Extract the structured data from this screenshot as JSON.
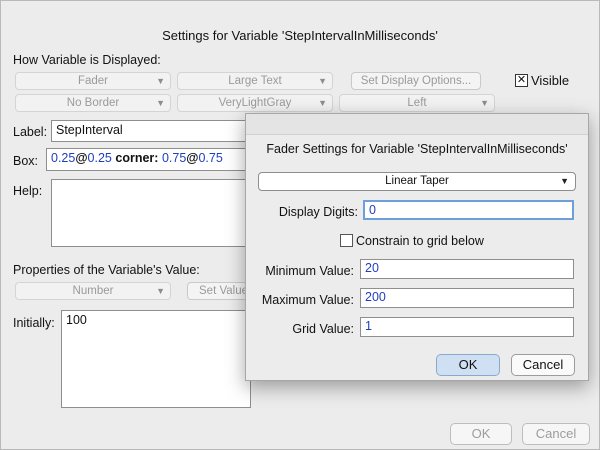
{
  "main": {
    "title": "Settings for Variable 'StepIntervalInMilliseconds'",
    "how_displayed_label": "How Variable is Displayed:",
    "display_popup1": "Fader",
    "display_popup2": "Large Text",
    "set_display_options": "Set Display Options...",
    "visible_label": "Visible",
    "visible_mark": "✕",
    "border_popup": "No Border",
    "color_popup": "VeryLightGray",
    "align_popup": "Left",
    "label_caption": "Label:",
    "label_value": "StepInterval",
    "box_caption": "Box:",
    "box_x": "0.25",
    "box_at1": "@",
    "box_y": "0.25",
    "corner_caption": "corner:",
    "corner_x": "0.75",
    "corner_at": "@",
    "corner_y": "0.75",
    "help_caption": "Help:",
    "properties_label": "Properties of the Variable's Value:",
    "type_popup": "Number",
    "set_value_button": "Set Value",
    "initially_caption": "Initially:",
    "initially_value": "100",
    "ok_button": "OK",
    "cancel_button": "Cancel"
  },
  "fader": {
    "title": "Fader Settings for Variable 'StepIntervalInMilliseconds'",
    "taper": "Linear Taper",
    "display_digits_label": "Display Digits:",
    "display_digits_value": "0",
    "constrain_label": "Constrain to grid below",
    "min_label": "Minimum Value:",
    "min_value": "20",
    "max_label": "Maximum Value:",
    "max_value": "200",
    "grid_label": "Grid Value:",
    "grid_value": "1",
    "ok_button": "OK",
    "cancel_button": "Cancel"
  },
  "colors": {
    "value_blue": "#1f3fbf",
    "default_button": "#cfe0f3"
  },
  "icons": [
    "dropdown-arrow-icon",
    "checkbox-checked-icon",
    "checkbox-empty-icon"
  ]
}
